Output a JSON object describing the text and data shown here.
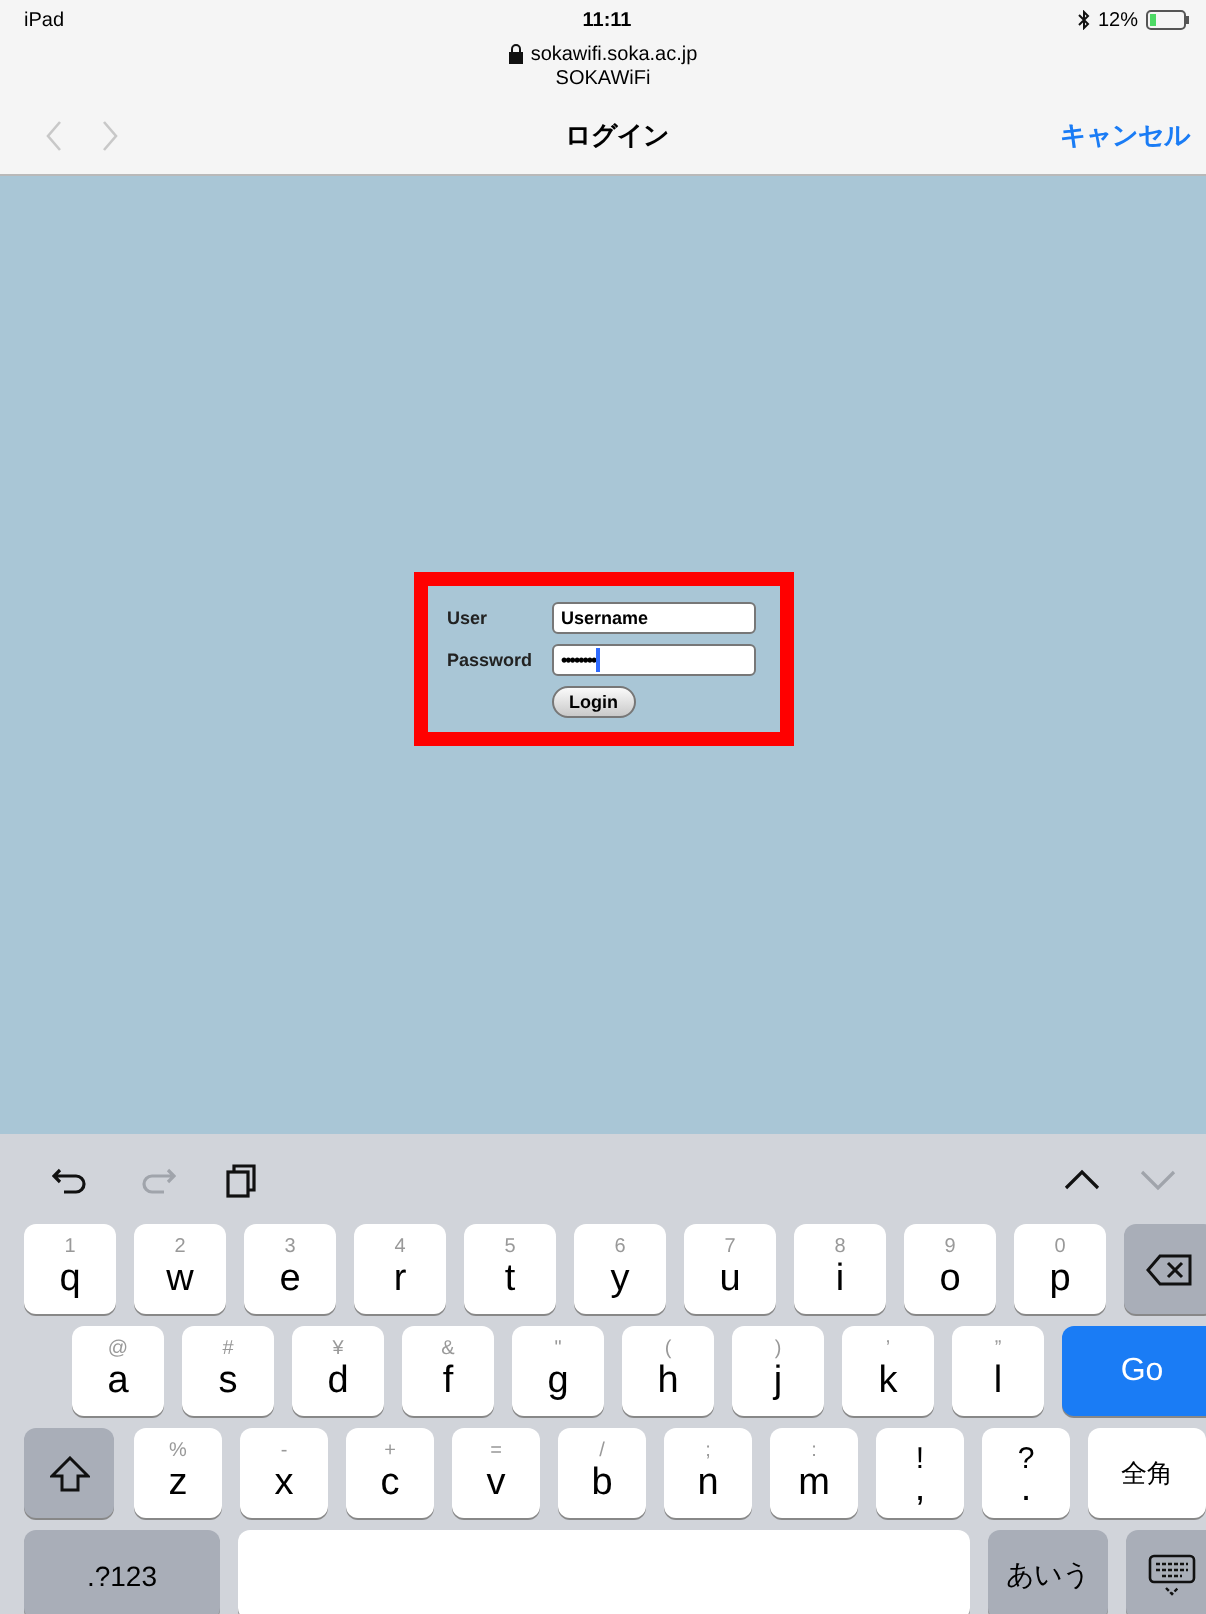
{
  "status_bar": {
    "device": "iPad",
    "time": "11:11",
    "battery": "12%",
    "bluetooth": true
  },
  "address": {
    "url": "sokawifi.soka.ac.jp",
    "secure": true,
    "site_title": "SOKAWiFi"
  },
  "nav": {
    "arrows": [
      {
        "kind": "back",
        "disabled": true
      },
      {
        "kind": "forward",
        "disabled": true
      }
    ],
    "title": "ログイン",
    "cancel": "キャンセル"
  },
  "login_form": {
    "highlighted": true,
    "fields": [
      {
        "label": "User",
        "kind": "text",
        "value": "Username",
        "focused": false
      },
      {
        "label": "Password",
        "kind": "password",
        "value": "••••••••",
        "focused": true
      }
    ],
    "button": "Login"
  },
  "keyboard": {
    "tools_left": [
      {
        "kind": "undo",
        "disabled": false
      },
      {
        "kind": "redo",
        "disabled": true
      },
      {
        "kind": "paste",
        "disabled": false
      }
    ],
    "tools_right": [
      {
        "kind": "up",
        "disabled": false
      },
      {
        "kind": "down",
        "disabled": true
      }
    ],
    "rows": [
      {
        "keys": [
          {
            "kind": "char",
            "label": "q",
            "alt": "1"
          },
          {
            "kind": "char",
            "label": "w",
            "alt": "2"
          },
          {
            "kind": "char",
            "label": "e",
            "alt": "3"
          },
          {
            "kind": "char",
            "label": "r",
            "alt": "4"
          },
          {
            "kind": "char",
            "label": "t",
            "alt": "5"
          },
          {
            "kind": "char",
            "label": "y",
            "alt": "6"
          },
          {
            "kind": "char",
            "label": "u",
            "alt": "7"
          },
          {
            "kind": "char",
            "label": "i",
            "alt": "8"
          },
          {
            "kind": "char",
            "label": "o",
            "alt": "9"
          },
          {
            "kind": "char",
            "label": "p",
            "alt": "0"
          },
          {
            "kind": "backspace"
          }
        ]
      },
      {
        "keys": [
          {
            "kind": "char",
            "label": "a",
            "alt": "@"
          },
          {
            "kind": "char",
            "label": "s",
            "alt": "#"
          },
          {
            "kind": "char",
            "label": "d",
            "alt": "¥"
          },
          {
            "kind": "char",
            "label": "f",
            "alt": "&"
          },
          {
            "kind": "char",
            "label": "g",
            "alt": "\""
          },
          {
            "kind": "char",
            "label": "h",
            "alt": "("
          },
          {
            "kind": "char",
            "label": "j",
            "alt": ")"
          },
          {
            "kind": "char",
            "label": "k",
            "alt": "’"
          },
          {
            "kind": "char",
            "label": "l",
            "alt": "”"
          },
          {
            "kind": "go",
            "label": "Go"
          }
        ]
      },
      {
        "keys": [
          {
            "kind": "shift"
          },
          {
            "kind": "char",
            "label": "z",
            "alt": "%"
          },
          {
            "kind": "char",
            "label": "x",
            "alt": "-"
          },
          {
            "kind": "char",
            "label": "c",
            "alt": "+"
          },
          {
            "kind": "char",
            "label": "v",
            "alt": "="
          },
          {
            "kind": "char",
            "label": "b",
            "alt": "/"
          },
          {
            "kind": "char",
            "label": "n",
            "alt": ";"
          },
          {
            "kind": "char",
            "label": "m",
            "alt": ":"
          },
          {
            "kind": "punct",
            "label": ",",
            "alt": "!"
          },
          {
            "kind": "punct",
            "label": ".",
            "alt": "?"
          },
          {
            "kind": "wide",
            "label": "全角"
          }
        ]
      },
      {
        "keys": [
          {
            "kind": "mode",
            "label": ".?123"
          },
          {
            "kind": "space"
          },
          {
            "kind": "mode",
            "label": "あいう"
          },
          {
            "kind": "hide"
          }
        ]
      }
    ]
  }
}
